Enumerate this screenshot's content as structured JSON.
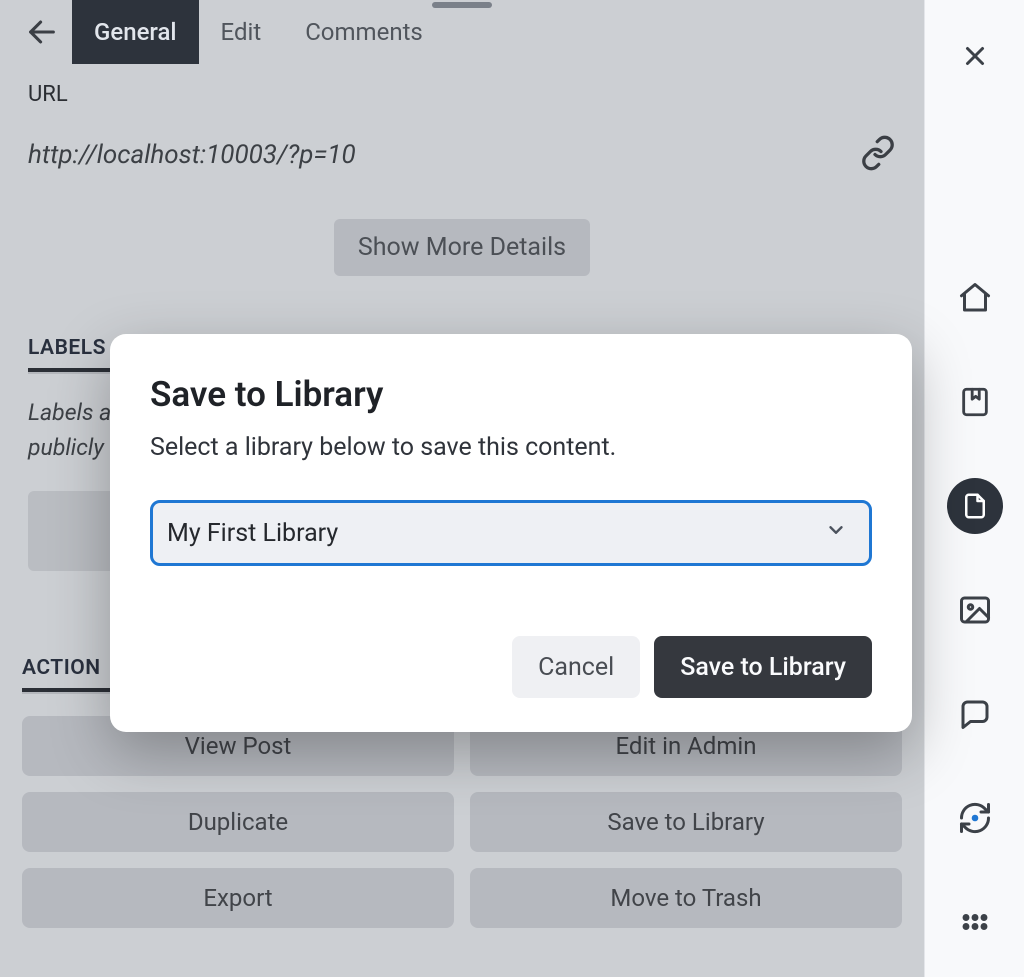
{
  "tabs": {
    "general": "General",
    "edit": "Edit",
    "comments": "Comments"
  },
  "url": {
    "label": "URL",
    "value": "http://localhost:10003/?p=10"
  },
  "show_more": "Show More Details",
  "labels": {
    "header": "LABELS",
    "desc_line1": "Labels a",
    "desc_line2": "publicly"
  },
  "actions": {
    "header": "ACTION",
    "view_post": "View Post",
    "edit_admin": "Edit in Admin",
    "duplicate": "Duplicate",
    "save_library": "Save to Library",
    "export": "Export",
    "move_trash": "Move to Trash"
  },
  "modal": {
    "title": "Save to Library",
    "subtitle": "Select a library below to save this content.",
    "selected": "My First Library",
    "cancel": "Cancel",
    "save": "Save to Library"
  }
}
